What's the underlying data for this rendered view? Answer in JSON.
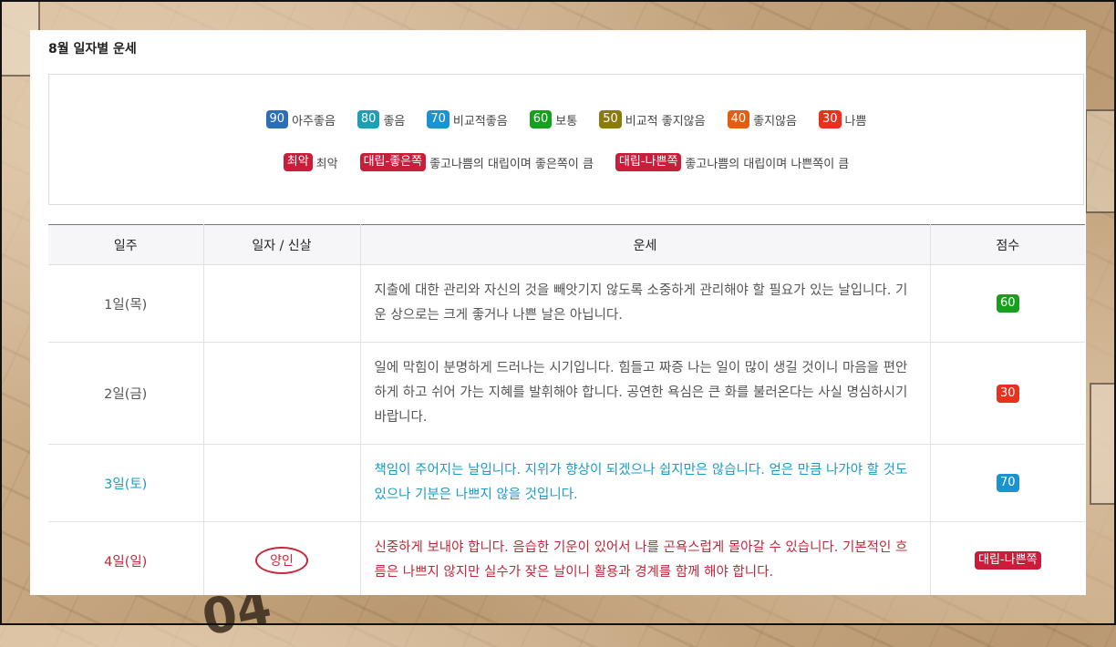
{
  "page_title": "8월 일자별 운세",
  "legend": {
    "row1": [
      {
        "badge": "90",
        "label": "아주좋음",
        "color": "#2a6fb6"
      },
      {
        "badge": "80",
        "label": "좋음",
        "color": "#1ea0b4"
      },
      {
        "badge": "70",
        "label": "비교적좋음",
        "color": "#1a93d0"
      },
      {
        "badge": "60",
        "label": "보통",
        "color": "#17a01e"
      },
      {
        "badge": "50",
        "label": "비교적 좋지않음",
        "color": "#8a7b0c"
      },
      {
        "badge": "40",
        "label": "좋지않음",
        "color": "#e55e10"
      },
      {
        "badge": "30",
        "label": "나쁨",
        "color": "#e8321e"
      }
    ],
    "row2": [
      {
        "badge": "최악",
        "label": "최악",
        "color": "#c81e3a"
      },
      {
        "badge": "대립-좋은쪽",
        "label": "좋고나쁨의 대립이며 좋은쪽이 큼",
        "color": "#c81e3a"
      },
      {
        "badge": "대립-나쁜쪽",
        "label": "좋고나쁨의 대립이며 나쁜쪽이 큼",
        "color": "#c81e3a"
      }
    ]
  },
  "table": {
    "headers": [
      "일주",
      "일자 / 신살",
      "운세",
      "점수"
    ],
    "rows": [
      {
        "day": "1일(목)",
        "sinsal": "",
        "text": "지출에 대한 관리와 자신의 것을 빼앗기지 않도록 소중하게 관리해야 할 필요가 있는 날입니다. 기운 상으로는 크게 좋거나 나쁜 날은 아닙니다.",
        "score": "60",
        "score_color": "#17a01e",
        "tone": "normal"
      },
      {
        "day": "2일(금)",
        "sinsal": "",
        "text": "일에 막힘이 분명하게 드러나는 시기입니다. 힘들고 짜증 나는 일이 많이 생길 것이니 마음을 편안하게 하고 쉬어 가는 지혜를 발휘해야 합니다. 공연한 욕심은 큰 화를 불러온다는 사실 명심하시기 바랍니다.",
        "score": "30",
        "score_color": "#e8321e",
        "tone": "normal"
      },
      {
        "day": "3일(토)",
        "sinsal": "",
        "text": "책임이 주어지는 날입니다. 지위가 향상이 되겠으나 쉽지만은 않습니다. 얻은 만큼 나가야 할 것도 있으나 기분은 나쁘지 않을 것입니다.",
        "score": "70",
        "score_color": "#1a93d0",
        "tone": "blue"
      },
      {
        "day": "4일(일)",
        "sinsal": "양인",
        "text": "신중하게 보내야 합니다. 음습한 기운이 있어서 나를 곤욕스럽게 몰아갈 수 있습니다. 기본적인 흐름은 나쁘지 않지만 실수가 잦은 날이니 활용과 경계를 함께 해야 합니다.",
        "score": "대립-나쁜쪽",
        "score_color": "#c81e3a",
        "tone": "red"
      }
    ]
  }
}
